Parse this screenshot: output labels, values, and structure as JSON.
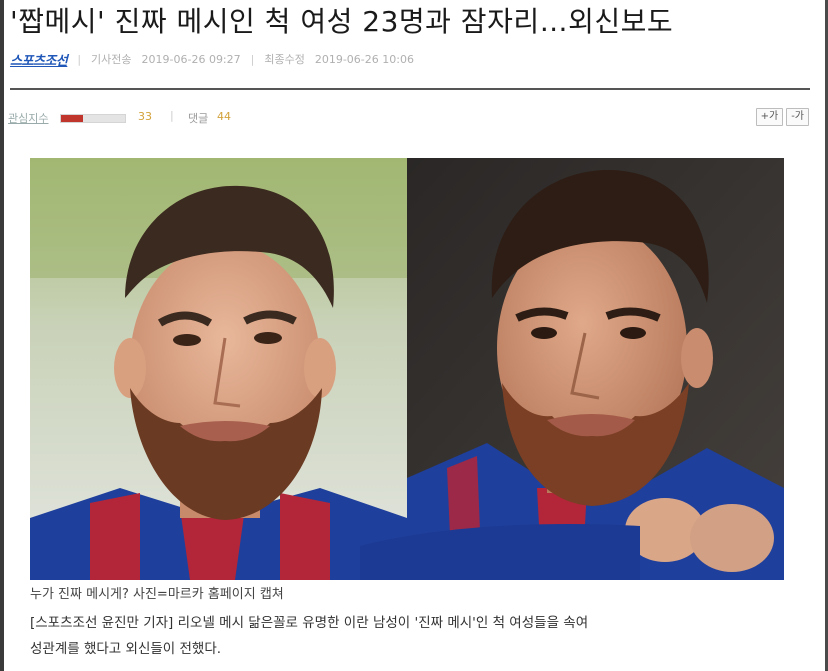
{
  "article": {
    "headline": "'짭메시' 진짜 메시인 척 여성 23명과 잠자리…외신보도",
    "source_logo": "스포츠조선",
    "published_label": "기사전송",
    "published": "2019-06-26 09:27",
    "updated_label": "최종수정",
    "updated": "2019-06-26 10:06"
  },
  "stats": {
    "interest_label": "관심지수",
    "interest_value": 33,
    "interest_fraction": 0.35,
    "comment_label": "댓글",
    "comment_count": 44
  },
  "font_buttons": {
    "increase": "+가",
    "decrease": "-가"
  },
  "photo": {
    "left_subject": "look-alike",
    "right_subject": "messi"
  },
  "caption": "누가 진짜 메시게? 사진=마르카 홈페이지 캡쳐",
  "body_lines": [
    "[스포츠조선 윤진만 기자] 리오넬 메시 닮은꼴로 유명한 이란 남성이 '진짜 메시'인 척 여성들을 속여",
    "성관계를 했다고 외신들이 전했다."
  ],
  "colors": {
    "logo": "#1f57b8",
    "bar_fill": "#c0362c",
    "count": "#d3a23a",
    "jersey_blue": "#1f3f9c",
    "jersey_red": "#b3263a"
  }
}
